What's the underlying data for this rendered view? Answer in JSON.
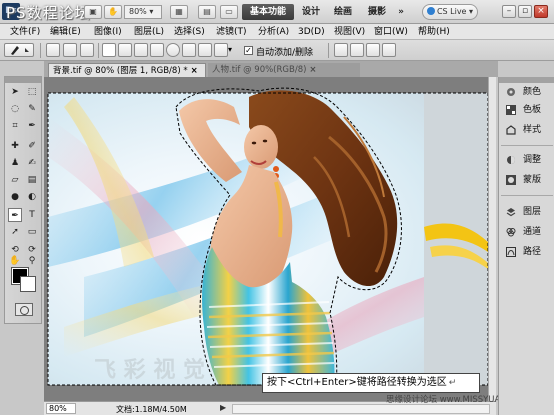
{
  "app": {
    "logo": "Ps",
    "watermark_title": "PS数程论坛",
    "zoom_level": "80%",
    "workspaces": [
      "基本功能",
      "设计",
      "绘画",
      "摄影",
      "»"
    ],
    "cs_live": "CS Live",
    "window_controls": [
      "minimize-icon",
      "restore-icon",
      "close-icon"
    ]
  },
  "menu": {
    "items": [
      "文件(F)",
      "编辑(E)",
      "图像(I)",
      "图层(L)",
      "选择(S)",
      "滤镜(T)",
      "分析(A)",
      "3D(D)",
      "视图(V)",
      "窗口(W)",
      "帮助(H)"
    ]
  },
  "options": {
    "auto_add_delete": "自动添加/删除",
    "auto_add_checked": true
  },
  "tabs": [
    {
      "label": "背景.tif @ 80% (图层 1, RGB/8) *",
      "close": "×",
      "active": true
    },
    {
      "label": "人物.tif @ 90%(RGB/8)",
      "close": "×",
      "active": false
    }
  ],
  "caption": {
    "text": "按下<Ctrl+Enter>键将路径转换为选区",
    "enter_icon": "↵"
  },
  "status": {
    "zoom": "80%",
    "doc_info": "文档:1.18M/4.50M",
    "arrow": "▶"
  },
  "watermark": "思缘设计论坛 www.MISSYUAN.COM",
  "right_panel": {
    "group1": [
      {
        "label": "颜色",
        "icon": "color-panel-icon"
      },
      {
        "label": "色板",
        "icon": "swatches-panel-icon"
      },
      {
        "label": "样式",
        "icon": "styles-panel-icon"
      }
    ],
    "group2": [
      {
        "label": "调整",
        "icon": "adjustments-panel-icon"
      },
      {
        "label": "蒙版",
        "icon": "masks-panel-icon"
      }
    ],
    "group3": [
      {
        "label": "图层",
        "icon": "layers-panel-icon"
      },
      {
        "label": "通道",
        "icon": "channels-panel-icon"
      },
      {
        "label": "路径",
        "icon": "paths-panel-icon"
      }
    ]
  },
  "colors": {
    "foreground": "#000000",
    "background": "#ffffff",
    "workspace_active": "#3a3a3a"
  }
}
